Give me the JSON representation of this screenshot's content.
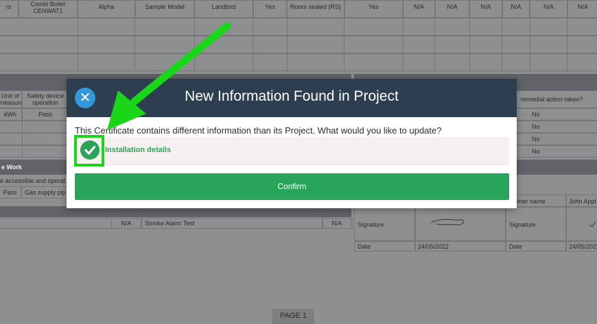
{
  "background": {
    "table_headers": [
      "rs",
      "Combi Boiler\nCENWAT1",
      "Alpha",
      "Sample Model",
      "Landlord",
      "Yes",
      "Room sealed (RS)",
      "Yes",
      "N/A",
      "N/A",
      "N/A",
      "N/A",
      "N/A",
      "N/A"
    ],
    "unit_of_measure": "Unit of\nmeasure",
    "safety_device": "Safety device\noperation",
    "kwh": "kWh",
    "pass": "Pass",
    "remedial": "remedial action taken?",
    "no_values": [
      "No",
      "No",
      "No",
      "No"
    ],
    "work_heading": "e Work",
    "accessible_text": "e accessible and operat",
    "pass2": "Pass",
    "gas_supply": "Gas supply pip",
    "na_a": "N/A",
    "smoke_alarm": "Smoke Alarm Test",
    "na_b": "N/A",
    "customer_name": "stomer name",
    "john": "John Appl",
    "signature_1": "Signature",
    "signature_2": "Signature",
    "date_1": "Date",
    "date_value_1": "24/05/2022",
    "date_2": "Date",
    "date_value_2": "24/05/2022",
    "page_label": "PAGE 1"
  },
  "modal": {
    "title": "New Information Found in Project",
    "close_icon": "close-icon",
    "message": "This Certificate contains different information than its Project. What would you like to update?",
    "option_label": "Installation details",
    "option_checked": true,
    "confirm_label": "Confirm"
  },
  "annotation": {
    "arrow_color": "#19d619",
    "highlight_color": "#19d619"
  },
  "colors": {
    "header_bg": "#2c3e50",
    "close_bg": "#3498db",
    "accent_green": "#27a55a"
  }
}
